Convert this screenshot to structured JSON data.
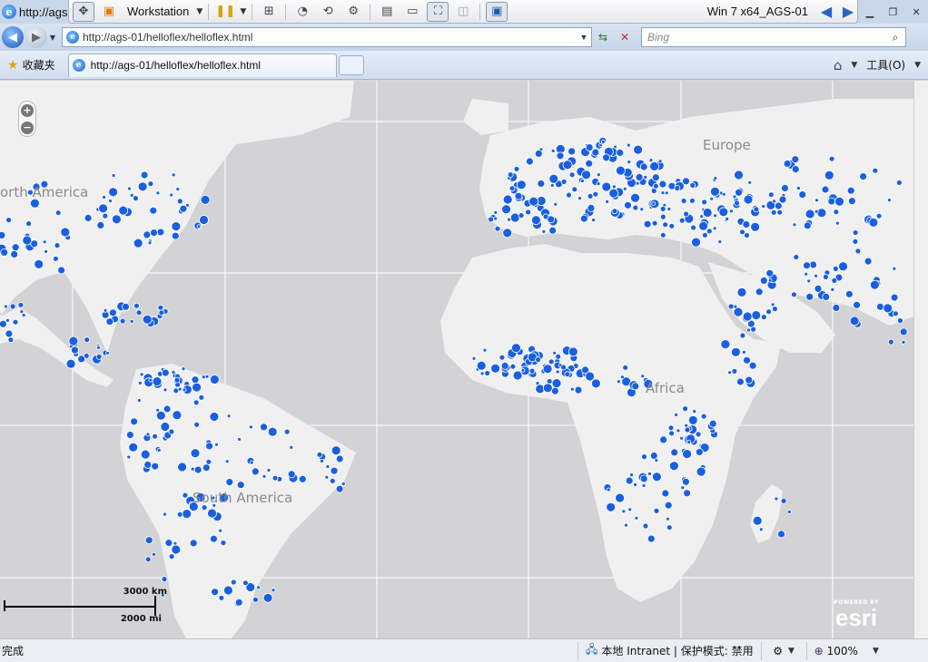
{
  "window": {
    "title": "http://ags",
    "vm_name": "Workstation",
    "guest_title": "Win 7 x64_AGS-01"
  },
  "address_bar": {
    "url": "http://ags-01/helloflex/helloflex.html",
    "search_placeholder": "Bing"
  },
  "tabs": {
    "favorites_label": "收藏夹",
    "active_tab": "http://ags-01/helloflex/helloflex.html",
    "tools_label": "工具(O)"
  },
  "map": {
    "labels": {
      "north_america": "orth America",
      "south_america": "South America",
      "europe": "Europe",
      "africa": "Africa"
    },
    "scale": {
      "km": "3000 km",
      "mi": "2000 mi"
    },
    "attribution": {
      "powered": "POWERED BY",
      "brand": "esri"
    },
    "colors": {
      "ocean": "#d3d3d6",
      "land": "#f0f0f0",
      "graticule": "#ffffff",
      "points": "#1a5fe0"
    }
  },
  "status_bar": {
    "text": "完成",
    "zone": "本地 Intranet | 保护模式: 禁用",
    "zoom": "100%"
  }
}
